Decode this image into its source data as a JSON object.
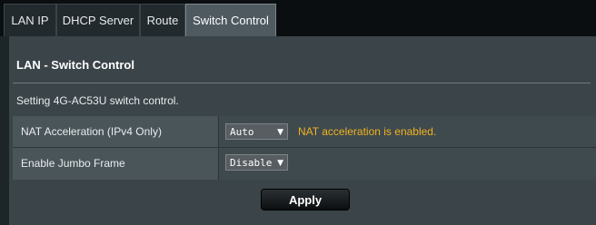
{
  "tabs": [
    {
      "label": "LAN IP",
      "active": false
    },
    {
      "label": "DHCP Server",
      "active": false
    },
    {
      "label": "Route",
      "active": false
    },
    {
      "label": "Switch Control",
      "active": true
    }
  ],
  "section": {
    "title": "LAN - Switch Control",
    "description": "Setting 4G-AC53U switch control."
  },
  "settings": [
    {
      "label": "NAT Acceleration (IPv4 Only)",
      "value": "Auto",
      "status": "NAT acceleration is enabled."
    },
    {
      "label": "Enable Jumbo Frame",
      "value": "Disable"
    }
  ],
  "actions": {
    "apply_label": "Apply"
  },
  "colors": {
    "status_text": "#f2b21c",
    "active_tab": "#4e5a60",
    "panel_background": "#3a4449"
  },
  "icons": {
    "dropdown": "chevron-down-icon"
  }
}
